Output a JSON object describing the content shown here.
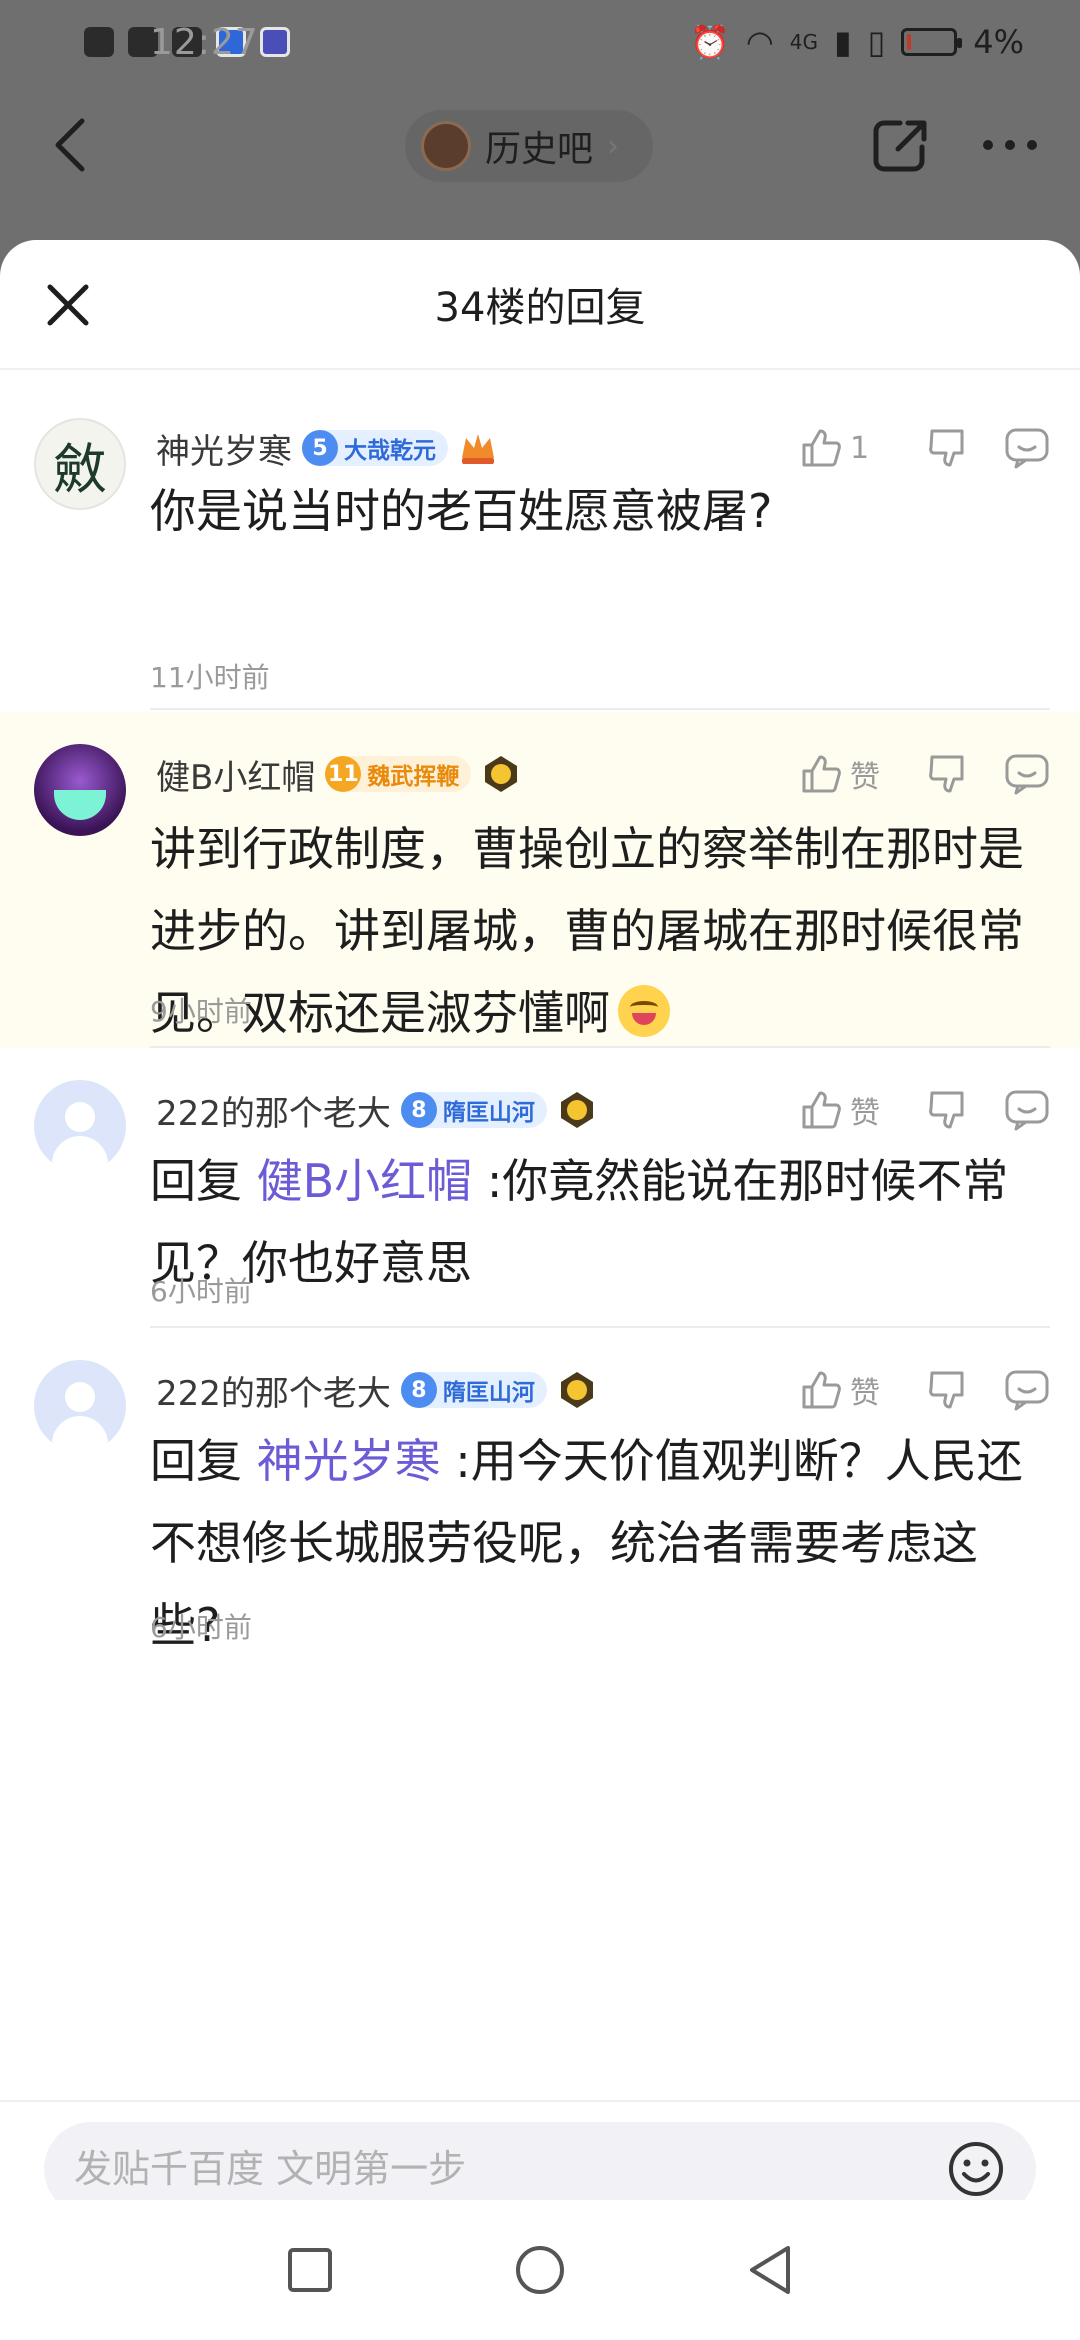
{
  "status_bar": {
    "time": "12:27",
    "network": "4G",
    "battery_text": "4%",
    "battery_level": 0.04
  },
  "forum": {
    "name": "历史吧"
  },
  "sheet": {
    "title": "34楼的回复"
  },
  "replies": [
    {
      "username": "神光岁寒",
      "avatar_text": "斂",
      "level": "5",
      "badge": "大哉乾元",
      "like_count": "1",
      "content_text": "你是说当时的老百姓愿意被屠?",
      "time": "11小时前"
    },
    {
      "username": "健B小红帽",
      "level": "11",
      "badge": "魏武挥鞭",
      "like_label": "赞",
      "content_text": "讲到行政制度，曹操创立的察举制在那时是进步的。讲到屠城，曹的屠城在那时候很常见。双标还是淑芬懂啊",
      "time": "9小时前"
    },
    {
      "username": "222的那个老大",
      "level": "8",
      "badge": "隋匡山河",
      "like_label": "赞",
      "reply_prefix": "回复",
      "mention": "健B小红帽",
      "content_text": ":你竟然能说在那时候不常见？你也好意思",
      "time": "6小时前"
    },
    {
      "username": "222的那个老大",
      "level": "8",
      "badge": "隋匡山河",
      "like_label": "赞",
      "reply_prefix": "回复",
      "mention": "神光岁寒",
      "content_text": ":用今天价值观判断？人民还不想修长城服劳役呢，统治者需要考虑这些?",
      "time": "6小时前"
    }
  ],
  "input": {
    "placeholder": "发贴千百度 文明第一步"
  },
  "icons": {
    "back": "back-arrow-icon",
    "share": "share-icon",
    "more": "more-icon",
    "close": "close-icon",
    "like": "thumbs-up-icon",
    "dislike": "thumbs-down-icon",
    "comment": "comment-icon",
    "emoji": "emoji-icon"
  },
  "colors": {
    "mention": "#6b5bd6",
    "highlight_bg": "#fefdf0",
    "level_blue": "#4d8cf0",
    "level_orange": "#f5a623"
  }
}
